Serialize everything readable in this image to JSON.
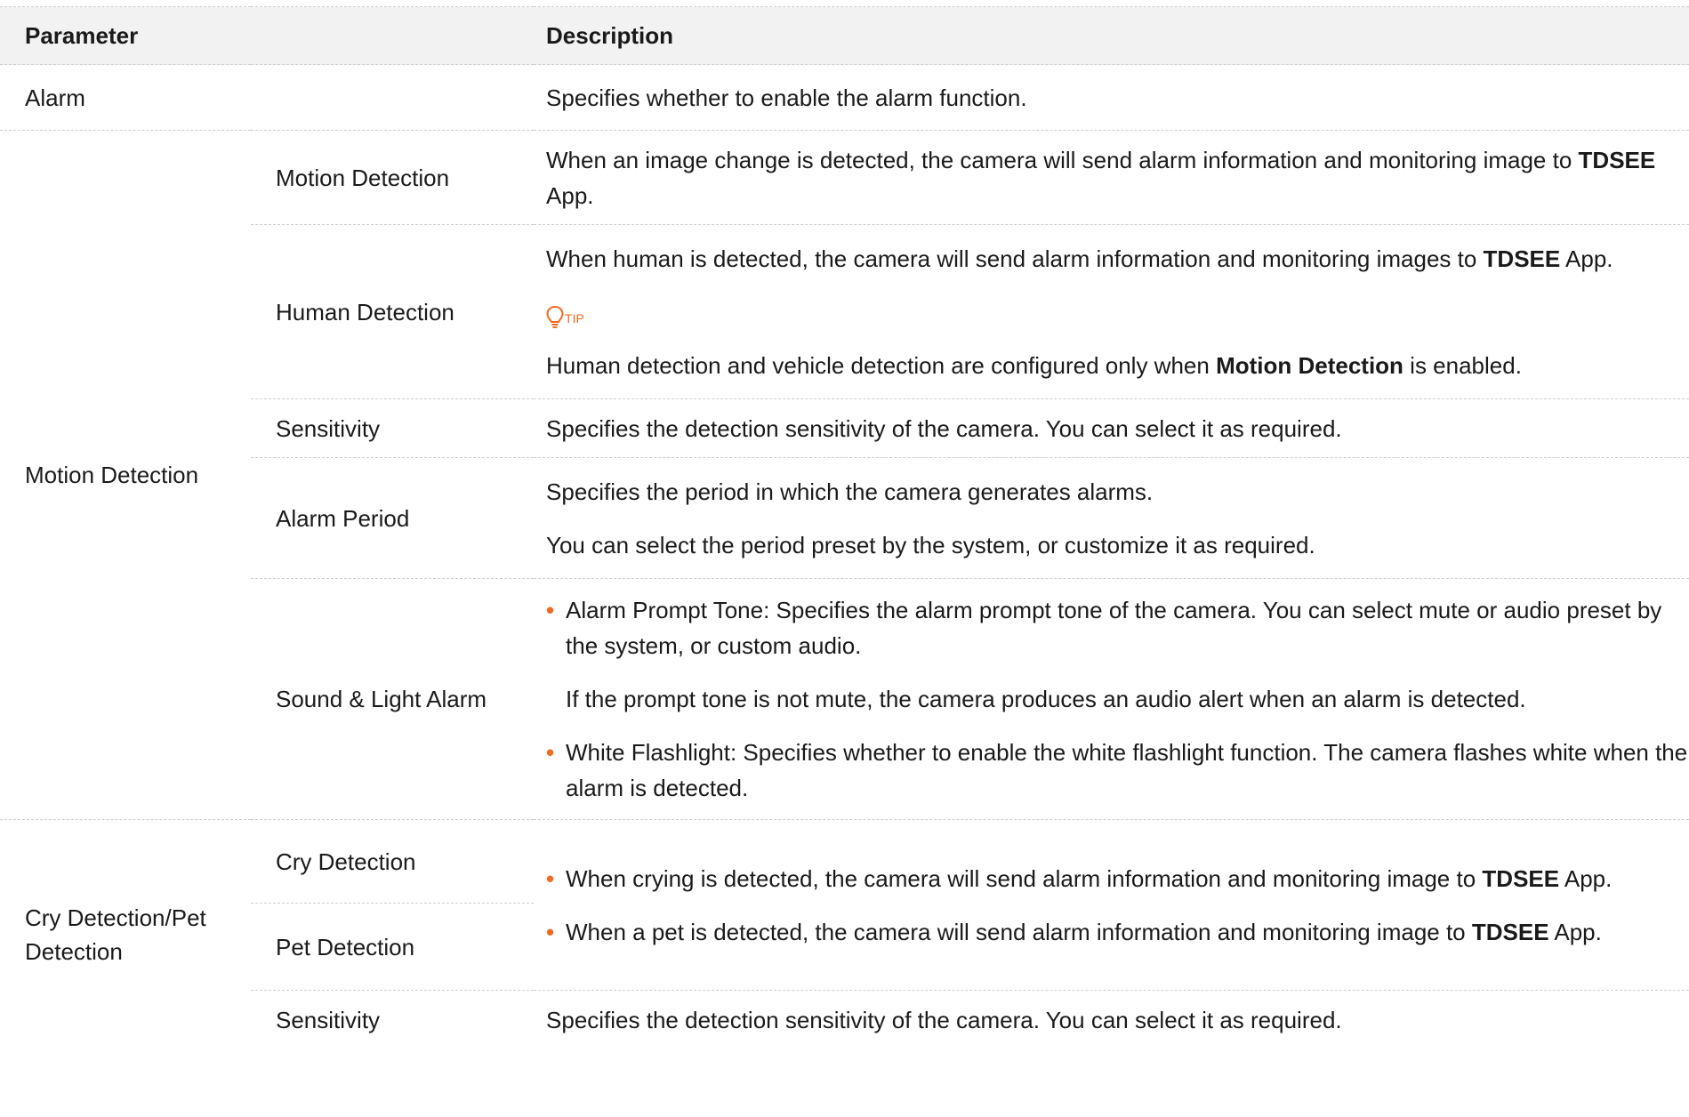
{
  "header": {
    "parameter": "Parameter",
    "description": "Description"
  },
  "rows": {
    "alarm": {
      "param": "Alarm",
      "desc": "Specifies whether to enable the alarm function."
    },
    "motion_group": "Motion Detection",
    "motion_detection": {
      "param": "Motion Detection",
      "desc_pre": "When an image change is detected, the camera will send alarm information and monitoring image to ",
      "desc_bold": "TDSEE",
      "desc_post": " App."
    },
    "human_detection": {
      "param": "Human Detection",
      "desc_pre": "When human is detected, the camera will send alarm information and monitoring images to ",
      "desc_bold": "TDSEE",
      "desc_post": " App.",
      "tip_label": "TIP",
      "tip_pre": "Human detection and vehicle detection are configured only when ",
      "tip_bold": "Motion Detection",
      "tip_post": " is enabled."
    },
    "sensitivity": {
      "param": "Sensitivity",
      "desc": "Specifies the detection sensitivity of the camera. You can select it as required."
    },
    "alarm_period": {
      "param": "Alarm Period",
      "desc1": "Specifies the period in which the camera generates alarms.",
      "desc2": "You can select the period preset by the system, or customize it as required."
    },
    "sound_light": {
      "param": "Sound & Light Alarm",
      "bullet1": "Alarm Prompt Tone: Specifies the alarm prompt tone of the camera. You can select mute or audio preset by the system, or custom audio.",
      "note": "If the prompt tone is not mute, the camera produces an audio alert when an alarm is detected.",
      "bullet2": "White Flashlight: Specifies whether to enable the white flashlight function. The camera flashes white when the alarm is detected."
    },
    "cry_group": "Cry Detection/Pet Detection",
    "cry_detection": {
      "param": "Cry Detection",
      "desc_pre": "When crying is detected, the camera will send alarm information and monitoring image to ",
      "desc_bold": "TDSEE",
      "desc_post": " App."
    },
    "pet_detection": {
      "param": "Pet Detection",
      "desc_pre": "When a pet is detected, the camera will send alarm information and monitoring image to ",
      "desc_bold": "TDSEE",
      "desc_post": " App."
    },
    "sensitivity2": {
      "param": "Sensitivity",
      "desc": "Specifies the detection sensitivity of the camera. You can select it as required."
    }
  },
  "colors": {
    "accent": "#f26a21",
    "header_bg": "#f2f2f2",
    "rule": "#cfcfcf"
  },
  "icons": {
    "tip": "lightbulb-icon",
    "bullet": "bullet-dot"
  }
}
